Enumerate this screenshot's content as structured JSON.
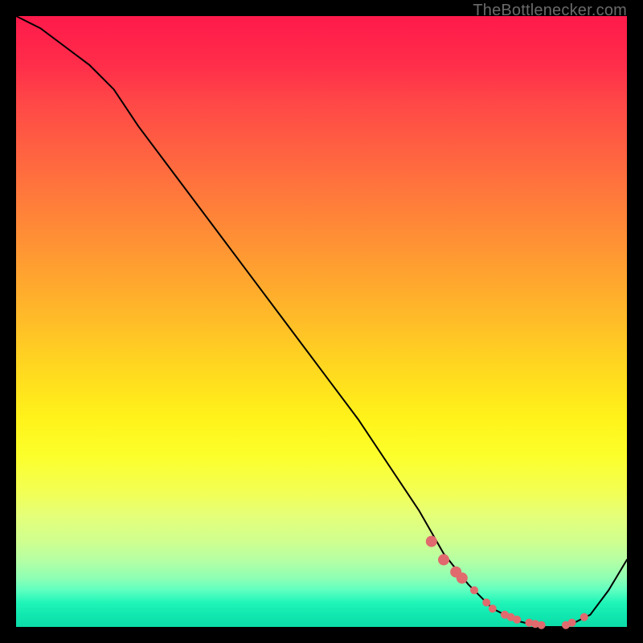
{
  "watermark": "TheBottlenecker.com",
  "colors": {
    "curve": "#000000",
    "dot": "#e06a6d"
  },
  "chart_data": {
    "type": "line",
    "title": "",
    "xlabel": "",
    "ylabel": "",
    "xlim": [
      0,
      100
    ],
    "ylim": [
      0,
      100
    ],
    "grid": false,
    "series": [
      {
        "name": "bottleneck-curve",
        "x": [
          0,
          4,
          8,
          12,
          16,
          20,
          26,
          32,
          38,
          44,
          50,
          56,
          62,
          66,
          70,
          74,
          78,
          82,
          86,
          90,
          94,
          97,
          100
        ],
        "y": [
          100,
          98,
          95,
          92,
          88,
          82,
          74,
          66,
          58,
          50,
          42,
          34,
          25,
          19,
          12,
          7,
          3,
          1,
          0,
          0,
          2,
          6,
          11
        ]
      }
    ],
    "markers": {
      "name": "highlight-dots",
      "x": [
        68,
        70,
        72,
        73,
        75,
        77,
        78,
        80,
        81,
        82,
        84,
        85,
        86,
        90,
        91,
        93
      ],
      "y": [
        14,
        11,
        9,
        8,
        6,
        4,
        3,
        2,
        1.6,
        1.2,
        0.7,
        0.5,
        0.3,
        0.3,
        0.7,
        1.6
      ]
    }
  }
}
